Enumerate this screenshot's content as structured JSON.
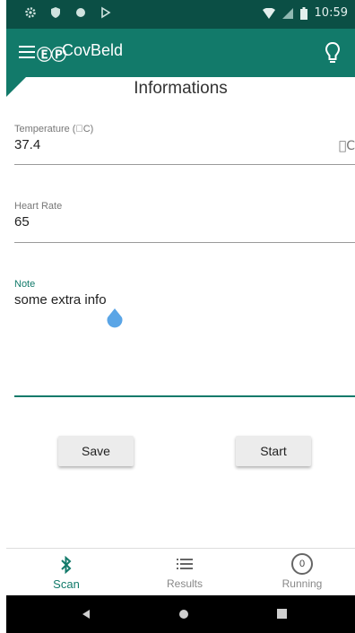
{
  "status_bar": {
    "time": "10:59",
    "icons": [
      "settings-icon",
      "shield-icon",
      "circle-icon",
      "play-icon",
      "wifi-icon",
      "signal-icon",
      "battery-icon"
    ]
  },
  "app_bar": {
    "logo": "ⒺⓅ",
    "title": "CovBeld",
    "icons": [
      "menu-icon",
      "lightbulb-icon"
    ]
  },
  "page": {
    "title": "Informations"
  },
  "form": {
    "temperature": {
      "label": "Temperature (\u0000C)",
      "value": "37.4",
      "unit": "\u0000C"
    },
    "heart_rate": {
      "label": "Heart Rate",
      "value": "65"
    },
    "note": {
      "label": "Note",
      "value": "some extra info"
    }
  },
  "buttons": {
    "save": "Save",
    "start": "Start"
  },
  "bottom_nav": {
    "scan": "Scan",
    "results": "Results",
    "running": "Running",
    "running_count": "0"
  },
  "colors": {
    "primary": "#127a6a",
    "status_bar": "#0b4f45",
    "cursor": "#5aa5e6"
  }
}
